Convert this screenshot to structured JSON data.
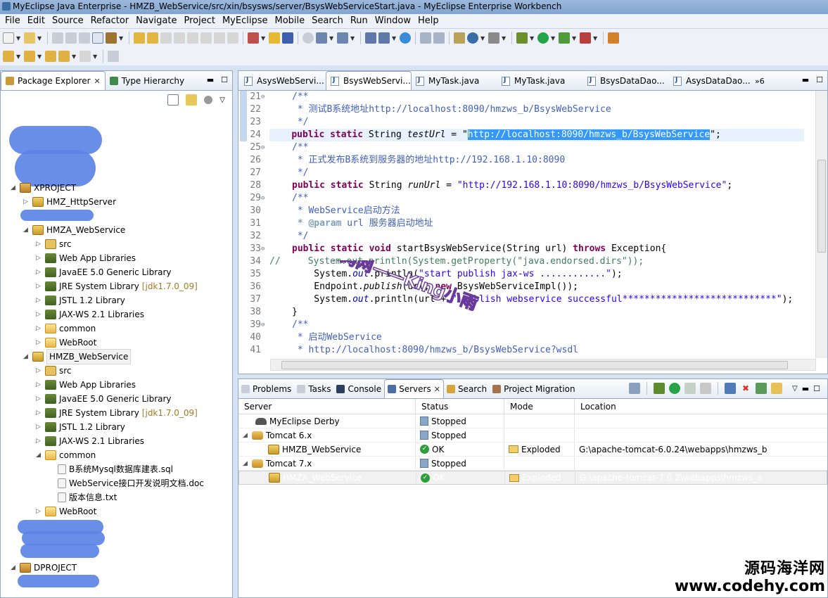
{
  "window": {
    "title": "MyEclipse Java Enterprise - HMZB_WebService/src/xin/bsysws/server/BsysWebServiceStart.java - MyEclipse Enterprise Workbench"
  },
  "menu": [
    "File",
    "Edit",
    "Source",
    "Refactor",
    "Navigate",
    "Project",
    "MyEclipse",
    "Mobile",
    "Search",
    "Run",
    "Window",
    "Help"
  ],
  "left_panel": {
    "tabs": [
      {
        "label": "Package Explorer",
        "active": true
      },
      {
        "label": "Type Hierarchy",
        "active": false
      }
    ],
    "tree": [
      {
        "label": "XPROJECT",
        "extra": ""
      },
      {
        "label": "HMZ_HttpServer",
        "extra": ""
      },
      {
        "label": "HMZA_WebService",
        "extra": ""
      },
      {
        "label": "src",
        "extra": ""
      },
      {
        "label": "Web App Libraries",
        "extra": ""
      },
      {
        "label": "JavaEE 5.0 Generic Library",
        "extra": ""
      },
      {
        "label": "JRE System Library",
        "extra": "[jdk1.7.0_09]"
      },
      {
        "label": "JSTL 1.2 Library",
        "extra": ""
      },
      {
        "label": "JAX-WS 2.1 Libraries",
        "extra": ""
      },
      {
        "label": "common",
        "extra": ""
      },
      {
        "label": "WebRoot",
        "extra": ""
      },
      {
        "label": "HMZB_WebService",
        "extra": ""
      },
      {
        "label": "src",
        "extra": ""
      },
      {
        "label": "Web App Libraries",
        "extra": ""
      },
      {
        "label": "JavaEE 5.0 Generic Library",
        "extra": ""
      },
      {
        "label": "JRE System Library",
        "extra": "[jdk1.7.0_09]"
      },
      {
        "label": "JSTL 1.2 Library",
        "extra": ""
      },
      {
        "label": "JAX-WS 2.1 Libraries",
        "extra": ""
      },
      {
        "label": "common",
        "extra": ""
      },
      {
        "label": "B系统Mysql数据库建表.sql",
        "extra": ""
      },
      {
        "label": "WebService接口开发说明文档.doc",
        "extra": ""
      },
      {
        "label": "版本信息.txt",
        "extra": ""
      },
      {
        "label": "WebRoot",
        "extra": ""
      },
      {
        "label": "DPROJECT",
        "extra": ""
      }
    ]
  },
  "editor": {
    "tabs": [
      "AsysWebServi...",
      "BsysWebServi...",
      "MyTask.java",
      "MyTask.java",
      "BsysDataDao...",
      "AsysDataDao..."
    ],
    "overflow": "»6",
    "line_numbers": [
      "21",
      "22",
      "23",
      "24",
      "25",
      "26",
      "27",
      "28",
      "29",
      "30",
      "31",
      "32",
      "33",
      "34",
      "35",
      "36",
      "37",
      "38",
      "39",
      "40",
      "41"
    ],
    "code": {
      "l21": "/**",
      "l22": " * 测试B系统地址http://localhost:8090/hmzws_b/BsysWebService",
      "l23": " */",
      "l24_kw": "public static",
      "l24_type": " String ",
      "l24_name": "testUrl",
      "l24_eq": " = \"",
      "l24_sel": "http://localhost:8090/hmzws_b/BsysWebService",
      "l24_end": "\";",
      "l25": "/**",
      "l26": " * 正式发布B系统到服务器的地址http://192.168.1.10:8090",
      "l27": " */",
      "l28_kw": "public static",
      "l28_type": " String ",
      "l28_name": "runUrl",
      "l28_eq": " = ",
      "l28_str": "\"http://192.168.1.10:8090/hmzws_b/BsysWebService\"",
      "l28_end": ";",
      "l29": "/**",
      "l30": " * WebService启动方法",
      "l31_tag": " * @param",
      "l31_rest": " url 服务器启动地址",
      "l32": " */",
      "l33_kw": "public static void",
      "l33_mid": " startBsysWebService(String url) ",
      "l33_kw2": "throws",
      "l33_end": " Exception{",
      "l34": "//     System.out.println(System.getProperty(\"java.endorsed.dirs\"));",
      "l35_a": "    System.",
      "l35_out": "out",
      "l35_b": ".println(",
      "l35_str": "\"start publish jax-ws ............\"",
      "l35_c": ");",
      "l36_a": "    Endpoint.",
      "l36_m": "publish",
      "l36_b": "(url, ",
      "l36_kw": "new",
      "l36_c": " BsysWebServiceImpl());",
      "l37_a": "    System.",
      "l37_out": "out",
      "l37_b": ".println(url + ",
      "l37_str": "\" publish webservice successful****************************\"",
      "l37_c": ");",
      "l38": "}",
      "l39": "/**",
      "l40": " * 启动WebService",
      "l41": " * http://localhost:8090/hmzws_b/BsysWebService?wsdl"
    },
    "watermark": "好的源码网——King小雨"
  },
  "servers_view": {
    "tabs": [
      {
        "label": "Problems",
        "active": false
      },
      {
        "label": "Tasks",
        "active": false
      },
      {
        "label": "Console",
        "active": false
      },
      {
        "label": "Servers",
        "active": true
      },
      {
        "label": "Search",
        "active": false
      },
      {
        "label": "Project Migration",
        "active": false
      }
    ],
    "columns": [
      "Server",
      "Status",
      "Mode",
      "Location"
    ],
    "rows": [
      {
        "server": "MyEclipse Derby",
        "status": "Stopped",
        "mode": "",
        "location": ""
      },
      {
        "server": "Tomcat  6.x",
        "status": "Stopped",
        "mode": "",
        "location": ""
      },
      {
        "server": "HMZB_WebService",
        "status": "OK",
        "mode": "Exploded",
        "location": "G:\\apache-tomcat-6.0.24\\webapps\\hmzws_b"
      },
      {
        "server": "Tomcat  7.x",
        "status": "Stopped",
        "mode": "",
        "location": ""
      },
      {
        "server": "HMZA_WebService",
        "status": "OK",
        "mode": "Exploded",
        "location": "G:\\apache-tomcat-7.0.2\\webapps\\hmzws_a"
      }
    ]
  },
  "branding": {
    "name": "源码海洋网",
    "url": "www.codehy.com"
  },
  "colors": {
    "selection": "#3399ff",
    "keyword": "#7f0055",
    "comment": "#3f5fbf",
    "string": "#2a00ff",
    "redaction": "#5b84e6"
  }
}
